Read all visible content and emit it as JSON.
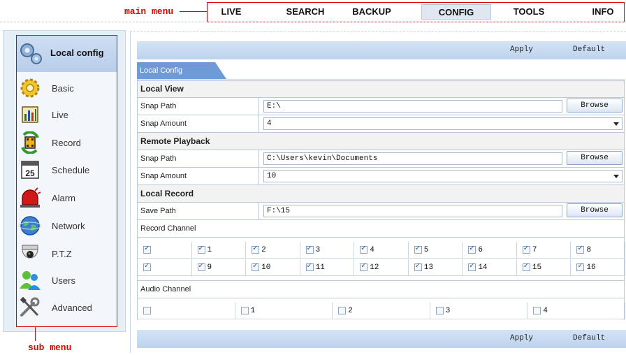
{
  "annotations": {
    "main_menu": "main menu",
    "sub_menu": "sub menu"
  },
  "main_menu": {
    "tabs": [
      "LIVE",
      "SEARCH",
      "BACKUP",
      "CONFIG",
      "TOOLS",
      "INFO"
    ],
    "active": "CONFIG"
  },
  "sidebar": {
    "header": "Local config",
    "items": [
      {
        "label": "Basic",
        "icon": "gear-icon"
      },
      {
        "label": "Live",
        "icon": "chart-icon"
      },
      {
        "label": "Record",
        "icon": "film-icon"
      },
      {
        "label": "Schedule",
        "icon": "calendar-icon"
      },
      {
        "label": "Alarm",
        "icon": "siren-icon"
      },
      {
        "label": "Network",
        "icon": "globe-icon"
      },
      {
        "label": "P.T.Z",
        "icon": "dome-camera-icon"
      },
      {
        "label": "Users",
        "icon": "users-icon"
      },
      {
        "label": "Advanced",
        "icon": "tools-icon"
      }
    ],
    "calendar_day": "25"
  },
  "toolbar": {
    "apply_label": "Apply",
    "default_label": "Default"
  },
  "tab_label": "Local Config",
  "local_view": {
    "title": "Local View",
    "snap_path_label": "Snap Path",
    "snap_path_value": "E:\\",
    "snap_amount_label": "Snap Amount",
    "snap_amount_value": "4",
    "browse_label": "Browse"
  },
  "remote_playback": {
    "title": "Remote Playback",
    "snap_path_label": "Snap Path",
    "snap_path_value": "C:\\Users\\kevin\\Documents",
    "snap_amount_label": "Snap Amount",
    "snap_amount_value": "10",
    "browse_label": "Browse"
  },
  "local_record": {
    "title": "Local Record",
    "save_path_label": "Save Path",
    "save_path_value": "F:\\15",
    "browse_label": "Browse",
    "record_channel_label": "Record Channel",
    "record_channels_row1": [
      "",
      "1",
      "2",
      "3",
      "4",
      "5",
      "6",
      "7",
      "8"
    ],
    "record_channels_row2": [
      "",
      "9",
      "10",
      "11",
      "12",
      "13",
      "14",
      "15",
      "16"
    ],
    "audio_channel_label": "Audio Channel",
    "audio_channels": [
      "",
      "1",
      "2",
      "3",
      "4"
    ]
  },
  "colors": {
    "annotation": "#e00000",
    "bar": "#c6dbf1",
    "tab": "#6e9ad8"
  }
}
